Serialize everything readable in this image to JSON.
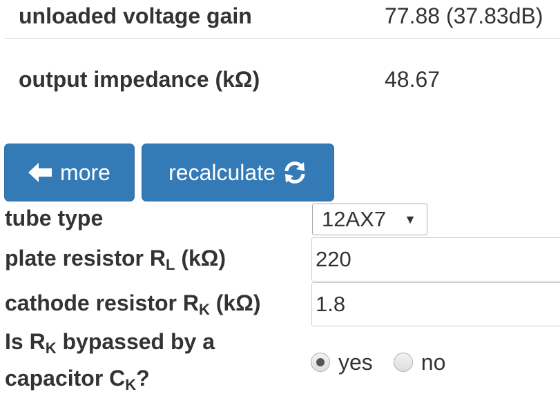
{
  "results": [
    {
      "label": "unloaded voltage gain",
      "value": "77.88 (37.83dB)"
    },
    {
      "label": "output impedance (kΩ)",
      "value": "48.67"
    }
  ],
  "buttons": {
    "more_label": "more",
    "recalculate_label": "recalculate"
  },
  "icons": {
    "more": "arrow-left-icon",
    "recalculate": "refresh-icon"
  },
  "colors": {
    "button_bg": "#337ab7",
    "button_text": "#ffffff",
    "text": "#333333"
  },
  "form": {
    "tube_type": {
      "label": "tube type",
      "selected": "12AX7"
    },
    "plate_resistor": {
      "label_pre": "plate resistor R",
      "label_sub": "L",
      "label_post": " (kΩ)",
      "value": "220"
    },
    "cathode_resistor": {
      "label_pre": "cathode resistor R",
      "label_sub": "K",
      "label_post": " (kΩ)",
      "value": "1.8"
    },
    "bypass": {
      "label_line1_pre": "Is R",
      "label_line1_sub": "K",
      "label_line1_post": " bypassed by a",
      "label_line2_pre": "capacitor C",
      "label_line2_sub": "K",
      "label_line2_post": "?",
      "options": [
        "yes",
        "no"
      ],
      "selected": "yes"
    }
  }
}
